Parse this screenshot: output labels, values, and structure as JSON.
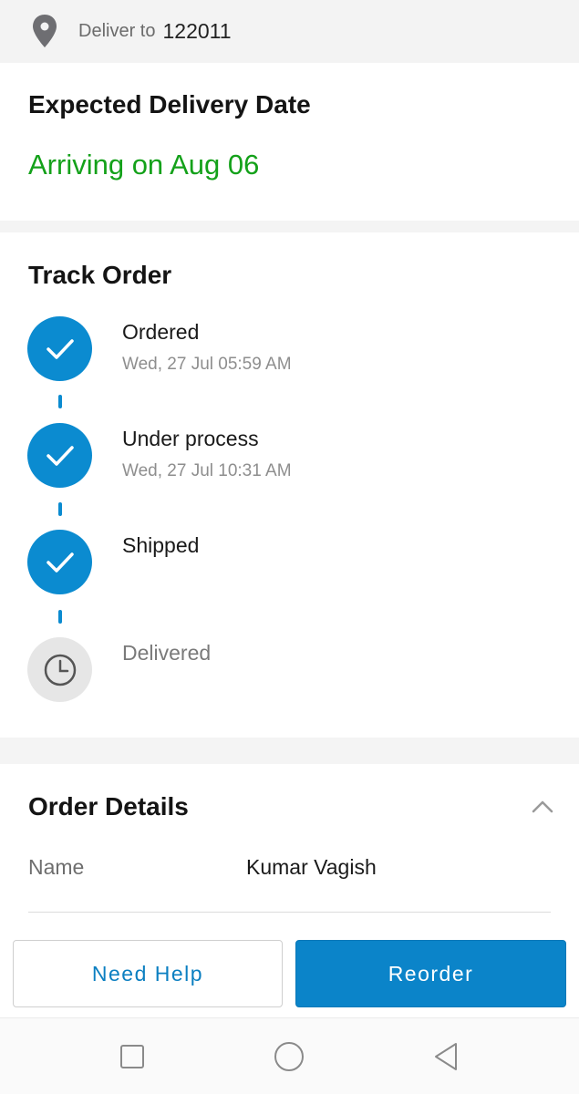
{
  "deliver": {
    "label": "Deliver to",
    "pincode": "122011"
  },
  "expected": {
    "title": "Expected Delivery Date",
    "status": "Arriving on Aug 06",
    "status_color": "#14a11a"
  },
  "track": {
    "title": "Track Order",
    "steps": [
      {
        "title": "Ordered",
        "time": "Wed, 27 Jul 05:59 AM",
        "done": true,
        "icon": "check-icon"
      },
      {
        "title": "Under process",
        "time": "Wed, 27 Jul 10:31 AM",
        "done": true,
        "icon": "check-icon"
      },
      {
        "title": "Shipped",
        "time": "",
        "done": true,
        "icon": "check-icon"
      },
      {
        "title": "Delivered",
        "time": "",
        "done": false,
        "icon": "clock-icon"
      }
    ],
    "accent_color": "#0b8bd0"
  },
  "details": {
    "title": "Order Details",
    "name_label": "Name",
    "name_value": "Kumar Vagish"
  },
  "actions": {
    "help_label": "Need Help",
    "reorder_label": "Reorder"
  },
  "system_nav": {
    "recent_icon": "square-icon",
    "home_icon": "circle-icon",
    "back_icon": "triangle-back-icon"
  }
}
